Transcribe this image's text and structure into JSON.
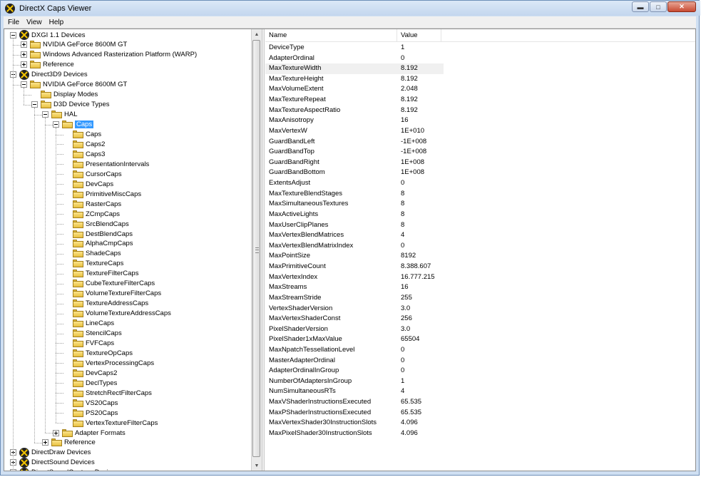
{
  "window": {
    "title": "DirectX Caps Viewer"
  },
  "menu": [
    "File",
    "View",
    "Help"
  ],
  "tree": [
    {
      "label": "DXGI 1.1 Devices",
      "icon": "directx-icon",
      "expander": "minus",
      "level": 0
    },
    {
      "label": "NVIDIA GeForce 8600M GT",
      "icon": "folder-icon",
      "expander": "plus",
      "level": 1
    },
    {
      "label": "Windows Advanced Rasterization Platform (WARP)",
      "icon": "folder-icon",
      "expander": "plus",
      "level": 1
    },
    {
      "label": "Reference",
      "icon": "folder-icon",
      "expander": "plus",
      "level": 1
    },
    {
      "label": "Direct3D9 Devices",
      "icon": "directx-icon",
      "expander": "minus",
      "level": 0
    },
    {
      "label": "NVIDIA GeForce 8600M GT",
      "icon": "folder-icon",
      "expander": "minus",
      "level": 1
    },
    {
      "label": "Display Modes",
      "icon": "folder-icon",
      "expander": "none",
      "level": 2
    },
    {
      "label": "D3D Device Types",
      "icon": "folder-icon",
      "expander": "minus",
      "level": 2
    },
    {
      "label": "HAL",
      "icon": "folder-icon",
      "expander": "minus",
      "level": 3
    },
    {
      "label": "Caps",
      "icon": "folder-icon",
      "expander": "minus",
      "level": 4,
      "selected": true
    },
    {
      "label": "Caps",
      "icon": "folder-icon",
      "expander": "none",
      "level": 5
    },
    {
      "label": "Caps2",
      "icon": "folder-icon",
      "expander": "none",
      "level": 5
    },
    {
      "label": "Caps3",
      "icon": "folder-icon",
      "expander": "none",
      "level": 5
    },
    {
      "label": "PresentationIntervals",
      "icon": "folder-icon",
      "expander": "none",
      "level": 5
    },
    {
      "label": "CursorCaps",
      "icon": "folder-icon",
      "expander": "none",
      "level": 5
    },
    {
      "label": "DevCaps",
      "icon": "folder-icon",
      "expander": "none",
      "level": 5
    },
    {
      "label": "PrimitiveMiscCaps",
      "icon": "folder-icon",
      "expander": "none",
      "level": 5
    },
    {
      "label": "RasterCaps",
      "icon": "folder-icon",
      "expander": "none",
      "level": 5
    },
    {
      "label": "ZCmpCaps",
      "icon": "folder-icon",
      "expander": "none",
      "level": 5
    },
    {
      "label": "SrcBlendCaps",
      "icon": "folder-icon",
      "expander": "none",
      "level": 5
    },
    {
      "label": "DestBlendCaps",
      "icon": "folder-icon",
      "expander": "none",
      "level": 5
    },
    {
      "label": "AlphaCmpCaps",
      "icon": "folder-icon",
      "expander": "none",
      "level": 5
    },
    {
      "label": "ShadeCaps",
      "icon": "folder-icon",
      "expander": "none",
      "level": 5
    },
    {
      "label": "TextureCaps",
      "icon": "folder-icon",
      "expander": "none",
      "level": 5
    },
    {
      "label": "TextureFilterCaps",
      "icon": "folder-icon",
      "expander": "none",
      "level": 5
    },
    {
      "label": "CubeTextureFilterCaps",
      "icon": "folder-icon",
      "expander": "none",
      "level": 5
    },
    {
      "label": "VolumeTextureFilterCaps",
      "icon": "folder-icon",
      "expander": "none",
      "level": 5
    },
    {
      "label": "TextureAddressCaps",
      "icon": "folder-icon",
      "expander": "none",
      "level": 5
    },
    {
      "label": "VolumeTextureAddressCaps",
      "icon": "folder-icon",
      "expander": "none",
      "level": 5
    },
    {
      "label": "LineCaps",
      "icon": "folder-icon",
      "expander": "none",
      "level": 5
    },
    {
      "label": "StencilCaps",
      "icon": "folder-icon",
      "expander": "none",
      "level": 5
    },
    {
      "label": "FVFCaps",
      "icon": "folder-icon",
      "expander": "none",
      "level": 5
    },
    {
      "label": "TextureOpCaps",
      "icon": "folder-icon",
      "expander": "none",
      "level": 5
    },
    {
      "label": "VertexProcessingCaps",
      "icon": "folder-icon",
      "expander": "none",
      "level": 5
    },
    {
      "label": "DevCaps2",
      "icon": "folder-icon",
      "expander": "none",
      "level": 5
    },
    {
      "label": "DeclTypes",
      "icon": "folder-icon",
      "expander": "none",
      "level": 5
    },
    {
      "label": "StretchRectFilterCaps",
      "icon": "folder-icon",
      "expander": "none",
      "level": 5
    },
    {
      "label": "VS20Caps",
      "icon": "folder-icon",
      "expander": "none",
      "level": 5
    },
    {
      "label": "PS20Caps",
      "icon": "folder-icon",
      "expander": "none",
      "level": 5
    },
    {
      "label": "VertexTextureFilterCaps",
      "icon": "folder-icon",
      "expander": "none",
      "level": 5
    },
    {
      "label": "Adapter Formats",
      "icon": "folder-icon",
      "expander": "plus",
      "level": 4
    },
    {
      "label": "Reference",
      "icon": "folder-icon",
      "expander": "plus",
      "level": 3
    },
    {
      "label": "DirectDraw Devices",
      "icon": "directx-icon",
      "expander": "plus",
      "level": 0
    },
    {
      "label": "DirectSound Devices",
      "icon": "directx-icon",
      "expander": "plus",
      "level": 0
    },
    {
      "label": "DirectSoundCapture Devices",
      "icon": "directx-icon",
      "expander": "plus",
      "level": 0
    }
  ],
  "list": {
    "columns": [
      "Name",
      "Value"
    ],
    "rows": [
      [
        "DeviceType",
        "1"
      ],
      [
        "AdapterOrdinal",
        "0"
      ],
      [
        "MaxTextureWidth",
        "8.192"
      ],
      [
        "MaxTextureHeight",
        "8.192"
      ],
      [
        "MaxVolumeExtent",
        "2.048"
      ],
      [
        "MaxTextureRepeat",
        "8.192"
      ],
      [
        "MaxTextureAspectRatio",
        "8.192"
      ],
      [
        "MaxAnisotropy",
        "16"
      ],
      [
        "MaxVertexW",
        "1E+010"
      ],
      [
        "GuardBandLeft",
        "-1E+008"
      ],
      [
        "GuardBandTop",
        "-1E+008"
      ],
      [
        "GuardBandRight",
        "1E+008"
      ],
      [
        "GuardBandBottom",
        "1E+008"
      ],
      [
        "ExtentsAdjust",
        "0"
      ],
      [
        "MaxTextureBlendStages",
        "8"
      ],
      [
        "MaxSimultaneousTextures",
        "8"
      ],
      [
        "MaxActiveLights",
        "8"
      ],
      [
        "MaxUserClipPlanes",
        "8"
      ],
      [
        "MaxVertexBlendMatrices",
        "4"
      ],
      [
        "MaxVertexBlendMatrixIndex",
        "0"
      ],
      [
        "MaxPointSize",
        "8192"
      ],
      [
        "MaxPrimitiveCount",
        "8.388.607"
      ],
      [
        "MaxVertexIndex",
        "16.777.215"
      ],
      [
        "MaxStreams",
        "16"
      ],
      [
        "MaxStreamStride",
        "255"
      ],
      [
        "VertexShaderVersion",
        "3.0"
      ],
      [
        "MaxVertexShaderConst",
        "256"
      ],
      [
        "PixelShaderVersion",
        "3.0"
      ],
      [
        "PixelShader1xMaxValue",
        "65504"
      ],
      [
        "MaxNpatchTessellationLevel",
        "0"
      ],
      [
        "MasterAdapterOrdinal",
        "0"
      ],
      [
        "AdapterOrdinalInGroup",
        "0"
      ],
      [
        "NumberOfAdaptersInGroup",
        "1"
      ],
      [
        "NumSimultaneousRTs",
        "4"
      ],
      [
        "MaxVShaderInstructionsExecuted",
        "65.535"
      ],
      [
        "MaxPShaderInstructionsExecuted",
        "65.535"
      ],
      [
        "MaxVertexShader30InstructionSlots",
        "4.096"
      ],
      [
        "MaxPixelShader30InstructionSlots",
        "4.096"
      ]
    ],
    "highlighted_row": "MaxTextureWidth"
  },
  "colors": {
    "selection": "#3399ff",
    "hover_row": "#f0f0f0",
    "title_bar": "#c3d6ee",
    "close_button": "#c84a32"
  }
}
